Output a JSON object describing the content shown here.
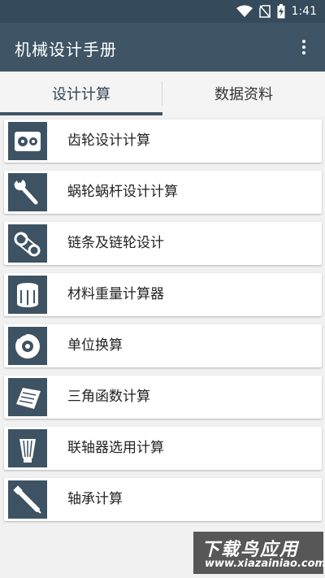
{
  "status_bar": {
    "time": "1:41",
    "icons": [
      "wifi-icon",
      "no-sim-icon",
      "battery-charging-icon"
    ]
  },
  "app_bar": {
    "title": "机械设计手册",
    "menu_icon": "overflow-menu-icon"
  },
  "tabs": [
    {
      "label": "设计计算",
      "active": true
    },
    {
      "label": "数据资料",
      "active": false
    }
  ],
  "items": [
    {
      "label": "齿轮设计计算",
      "icon": "gear-box-icon"
    },
    {
      "label": "蜗轮蜗杆设计计算",
      "icon": "wrench-icon"
    },
    {
      "label": "链条及链轮设计",
      "icon": "chain-drive-icon"
    },
    {
      "label": "材料重量计算器",
      "icon": "filter-cylinder-icon"
    },
    {
      "label": "单位换算",
      "icon": "brake-disc-icon"
    },
    {
      "label": "三角函数计算",
      "icon": "air-filter-panel-icon"
    },
    {
      "label": "联轴器选用计算",
      "icon": "cone-filter-icon"
    },
    {
      "label": "轴承计算",
      "icon": "spark-plug-icon"
    }
  ],
  "watermark": {
    "brand": "下载鸟应用",
    "url": "www.xiazainiao.com"
  },
  "colors": {
    "primary": "#3f5566",
    "status_bar": "#354a5a",
    "background": "#f1f1f1"
  }
}
